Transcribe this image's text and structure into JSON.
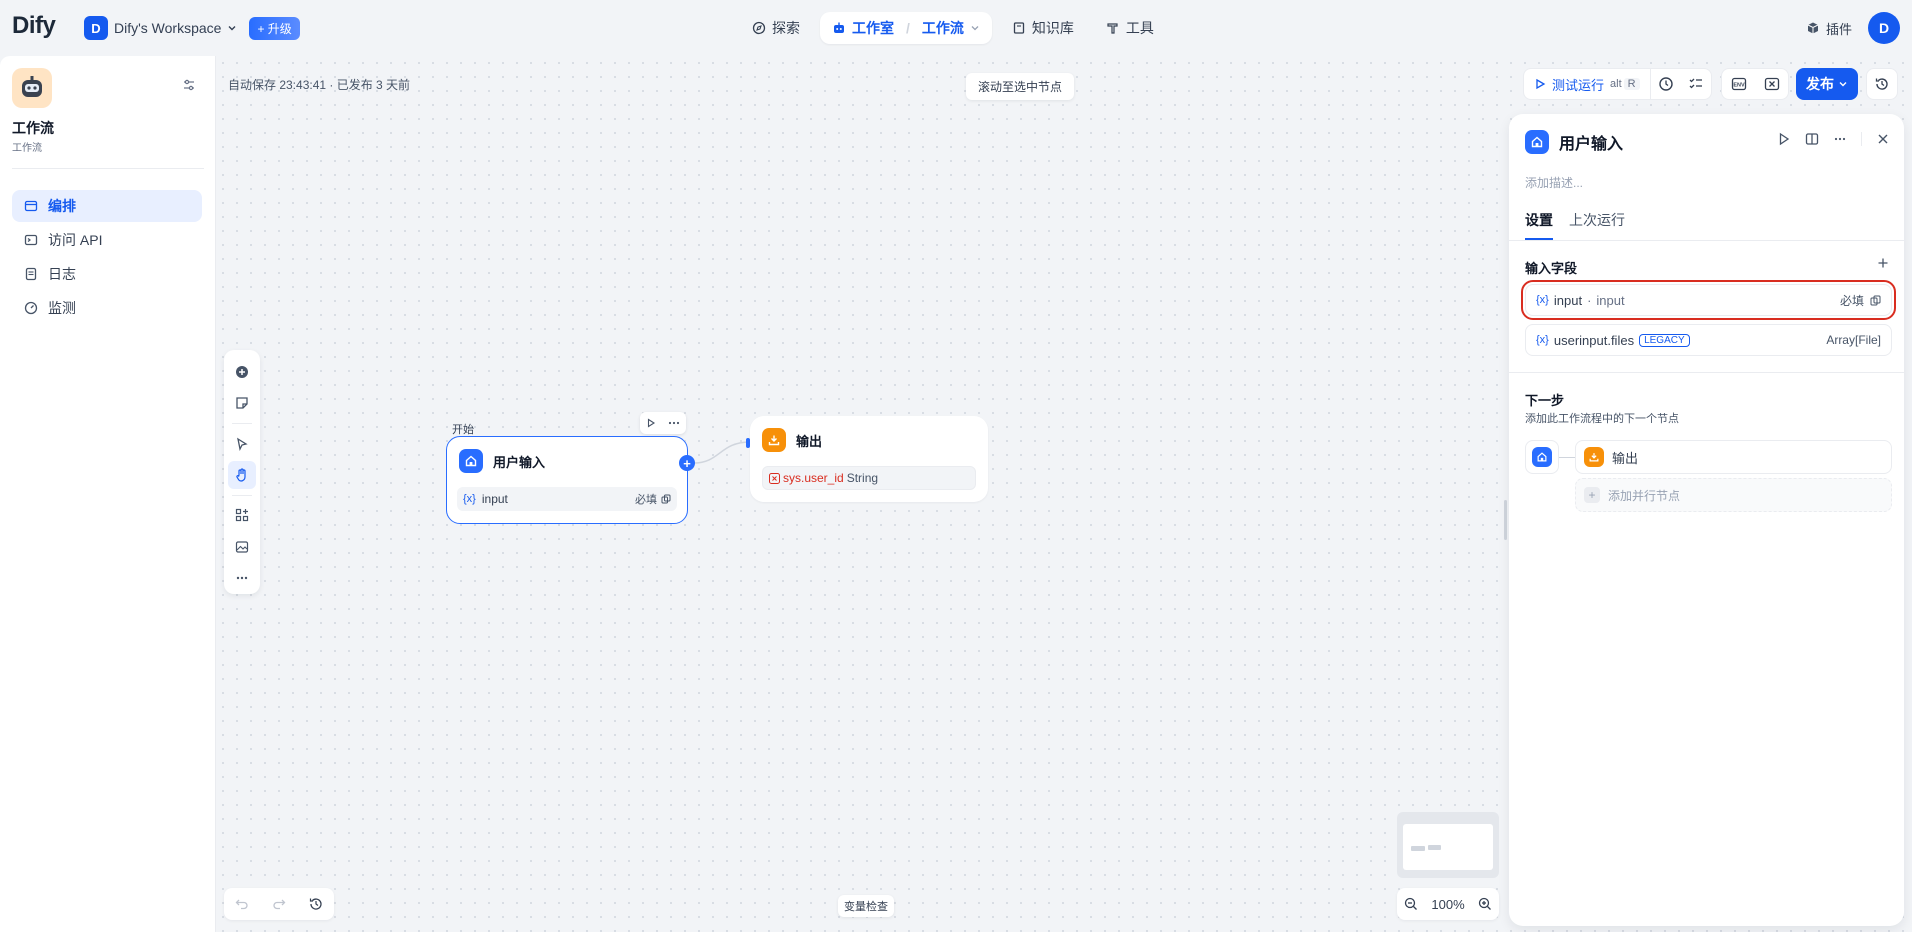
{
  "topbar": {
    "logo": "Dify",
    "workspace_initial": "D",
    "workspace_name": "Dify's Workspace",
    "upgrade_label": "升级",
    "nav": {
      "explore": "探索",
      "studio": "工作室",
      "workflow": "工作流",
      "knowledge": "知识库",
      "tools": "工具"
    },
    "plugins": "插件",
    "user_initial": "D"
  },
  "sidebar": {
    "app_name": "工作流",
    "app_type": "工作流",
    "items": [
      {
        "label": "编排",
        "icon": "layout-icon",
        "active": true
      },
      {
        "label": "访问 API",
        "icon": "terminal-icon",
        "active": false
      },
      {
        "label": "日志",
        "icon": "file-list-icon",
        "active": false
      },
      {
        "label": "监测",
        "icon": "dashboard-icon",
        "active": false
      }
    ]
  },
  "canvas": {
    "autosave": "自动保存 23:43:41 · 已发布 3 天前",
    "scroll_to_selected": "滚动至选中节点",
    "test_run": "测试运行",
    "shortcut_alt": "alt",
    "shortcut_key": "R",
    "env_label": "ENV",
    "publish": "发布",
    "var_check": "变量检查",
    "zoom": "100%"
  },
  "nodes": {
    "start_label": "开始",
    "start_title": "用户输入",
    "start_var": "input",
    "start_var_required": "必填",
    "end_title": "输出",
    "end_var_prefix": "sys.user_id",
    "end_var_type": "String"
  },
  "panel": {
    "title": "用户输入",
    "description_placeholder": "添加描述...",
    "tabs": [
      "设置",
      "上次运行"
    ],
    "input_fields_title": "输入字段",
    "fields": [
      {
        "name": "input",
        "label": "input",
        "right": "必填"
      },
      {
        "name": "userinput.files",
        "badge": "LEGACY",
        "right": "Array[File]"
      }
    ],
    "next_step_title": "下一步",
    "next_step_sub": "添加此工作流程中的下一个节点",
    "next_node": "输出",
    "add_parallel": "添加并行节点"
  },
  "colors": {
    "accent": "#155aef",
    "orange": "#f79009",
    "highlight": "#d92d20"
  }
}
